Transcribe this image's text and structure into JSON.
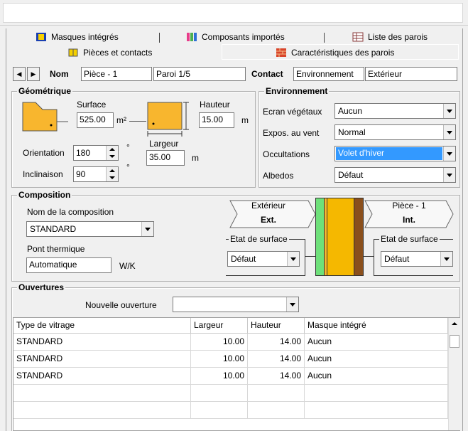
{
  "tabs": {
    "row1": [
      {
        "label": "Masques intégrés",
        "icon": "masks-icon"
      },
      {
        "label": "Composants importés",
        "icon": "components-icon"
      },
      {
        "label": "Liste des parois",
        "icon": "list-icon"
      }
    ],
    "row2": [
      {
        "label": "Pièces et contacts",
        "icon": "rooms-icon"
      },
      {
        "label": "Caractéristiques des parois",
        "icon": "wall-icon",
        "active": true
      }
    ]
  },
  "nav": {
    "nom_label": "Nom",
    "nom_value": "Pièce - 1",
    "paroi_value": "Paroi 1/5",
    "contact_label": "Contact",
    "contact_env": "Environnement",
    "contact_side": "Extérieur"
  },
  "geometrique": {
    "title": "Géométrique",
    "surface_label": "Surface",
    "surface_value": "525.00",
    "surface_unit": "m²",
    "hauteur_label": "Hauteur",
    "hauteur_value": "15.00",
    "hauteur_unit": "m",
    "largeur_label": "Largeur",
    "largeur_value": "35.00",
    "largeur_unit": "m",
    "orientation_label": "Orientation",
    "orientation_value": "180",
    "orientation_unit": "°",
    "inclinaison_label": "Inclinaison",
    "inclinaison_value": "90",
    "inclinaison_unit": "°"
  },
  "environnement": {
    "title": "Environnement",
    "rows": [
      {
        "label": "Ecran végétaux",
        "value": "Aucun",
        "selected": false
      },
      {
        "label": "Expos. au vent",
        "value": "Normal",
        "selected": false
      },
      {
        "label": "Occultations",
        "value": "Volet d'hiver",
        "selected": true
      },
      {
        "label": "Albedos",
        "value": "Défaut",
        "selected": false
      }
    ]
  },
  "composition": {
    "title": "Composition",
    "nom_label": "Nom de la composition",
    "nom_value": "STANDARD",
    "pont_label": "Pont thermique",
    "pont_value": "Automatique",
    "pont_unit": "W/K",
    "ext_label": "Extérieur",
    "ext_short": "Ext.",
    "int_label": "Pièce - 1",
    "int_short": "Int.",
    "etat_label_ext": "Etat de surface",
    "etat_value_ext": "Défaut",
    "etat_label_int": "Etat de surface",
    "etat_value_int": "Défaut"
  },
  "ouvertures": {
    "title": "Ouvertures",
    "nouvelle_label": "Nouvelle ouverture",
    "nouvelle_value": "",
    "columns": [
      "Type de vitrage",
      "Largeur",
      "Hauteur",
      "Masque intégré"
    ],
    "rows": [
      [
        "STANDARD",
        "10.00",
        "14.00",
        "Aucun"
      ],
      [
        "STANDARD",
        "10.00",
        "14.00",
        "Aucun"
      ],
      [
        "STANDARD",
        "10.00",
        "14.00",
        "Aucun"
      ]
    ]
  },
  "colors": {
    "wall_orange": "#f8b62e",
    "layer_green": "#6ee07a",
    "layer_brown": "#8a4f1c",
    "layer_gold": "#f5b800",
    "selection_blue": "#3399ff"
  }
}
